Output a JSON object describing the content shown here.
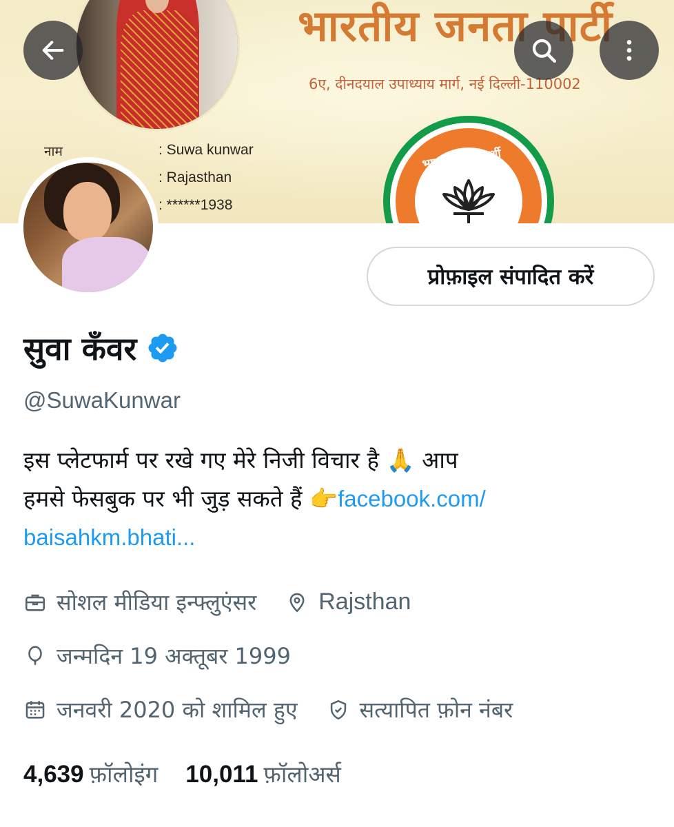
{
  "banner": {
    "party_title": "भारतीय जनता पार्टी",
    "party_address": "6ए, दीनदयाल उपाध्याय मार्ग, नई दिल्ली-110002",
    "details": {
      "name_label": "नाम",
      "name_value": ": Suwa kunwar",
      "state_value": ": Rajasthan",
      "number_value": ": ******1938"
    },
    "logo_text": "भाजपा - सर्वस्पर्शी"
  },
  "toolbar": {
    "back_icon": "arrow-left-icon",
    "search_icon": "search-icon",
    "more_icon": "more-vertical-icon"
  },
  "profile": {
    "edit_button_label": "प्रोफ़ाइल संपादित करें",
    "display_name": "सुवा कँवर",
    "verified_icon": "verified-badge-icon",
    "verified_color": "#1d9bf0",
    "handle": "@SuwaKunwar",
    "bio_line1": "इस प्लेटफार्म पर रखे गए मेरे निजी विचार है 🙏  आप",
    "bio_line2_text": "हमसे फेसबुक पर भी जुड़ सकते हैं 👉",
    "bio_link_part1": "facebook.com/",
    "bio_link_part2": "baisahkm.bhati..."
  },
  "meta": {
    "profession": "सोशल मीडिया इन्फ्लुएंसर",
    "location": "Rajsthan",
    "birthday": "जन्मदिन 19 अक्तूबर 1999",
    "joined": "जनवरी 2020 को शामिल हुए",
    "verified_phone": "सत्यापित फ़ोन नंबर"
  },
  "stats": {
    "following_count": "4,639",
    "following_label": "फ़ॉलोइंग",
    "followers_count": "10,011",
    "followers_label": "फ़ॉलोअर्स"
  }
}
